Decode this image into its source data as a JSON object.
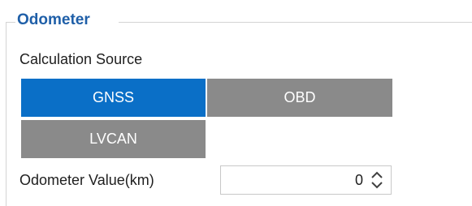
{
  "group": {
    "title": "Odometer"
  },
  "calculation_source": {
    "label": "Calculation Source",
    "options": [
      {
        "label": "GNSS",
        "selected": true
      },
      {
        "label": "OBD",
        "selected": false
      },
      {
        "label": "LVCAN",
        "selected": false
      }
    ]
  },
  "odometer_value": {
    "label": "Odometer Value(km)",
    "value": "0"
  },
  "colors": {
    "accent": "#0a6fc7",
    "inactive_button": "#8a8a8a",
    "title": "#1f5fa8"
  },
  "icons": {
    "spinner": "up-down-arrows-icon"
  }
}
